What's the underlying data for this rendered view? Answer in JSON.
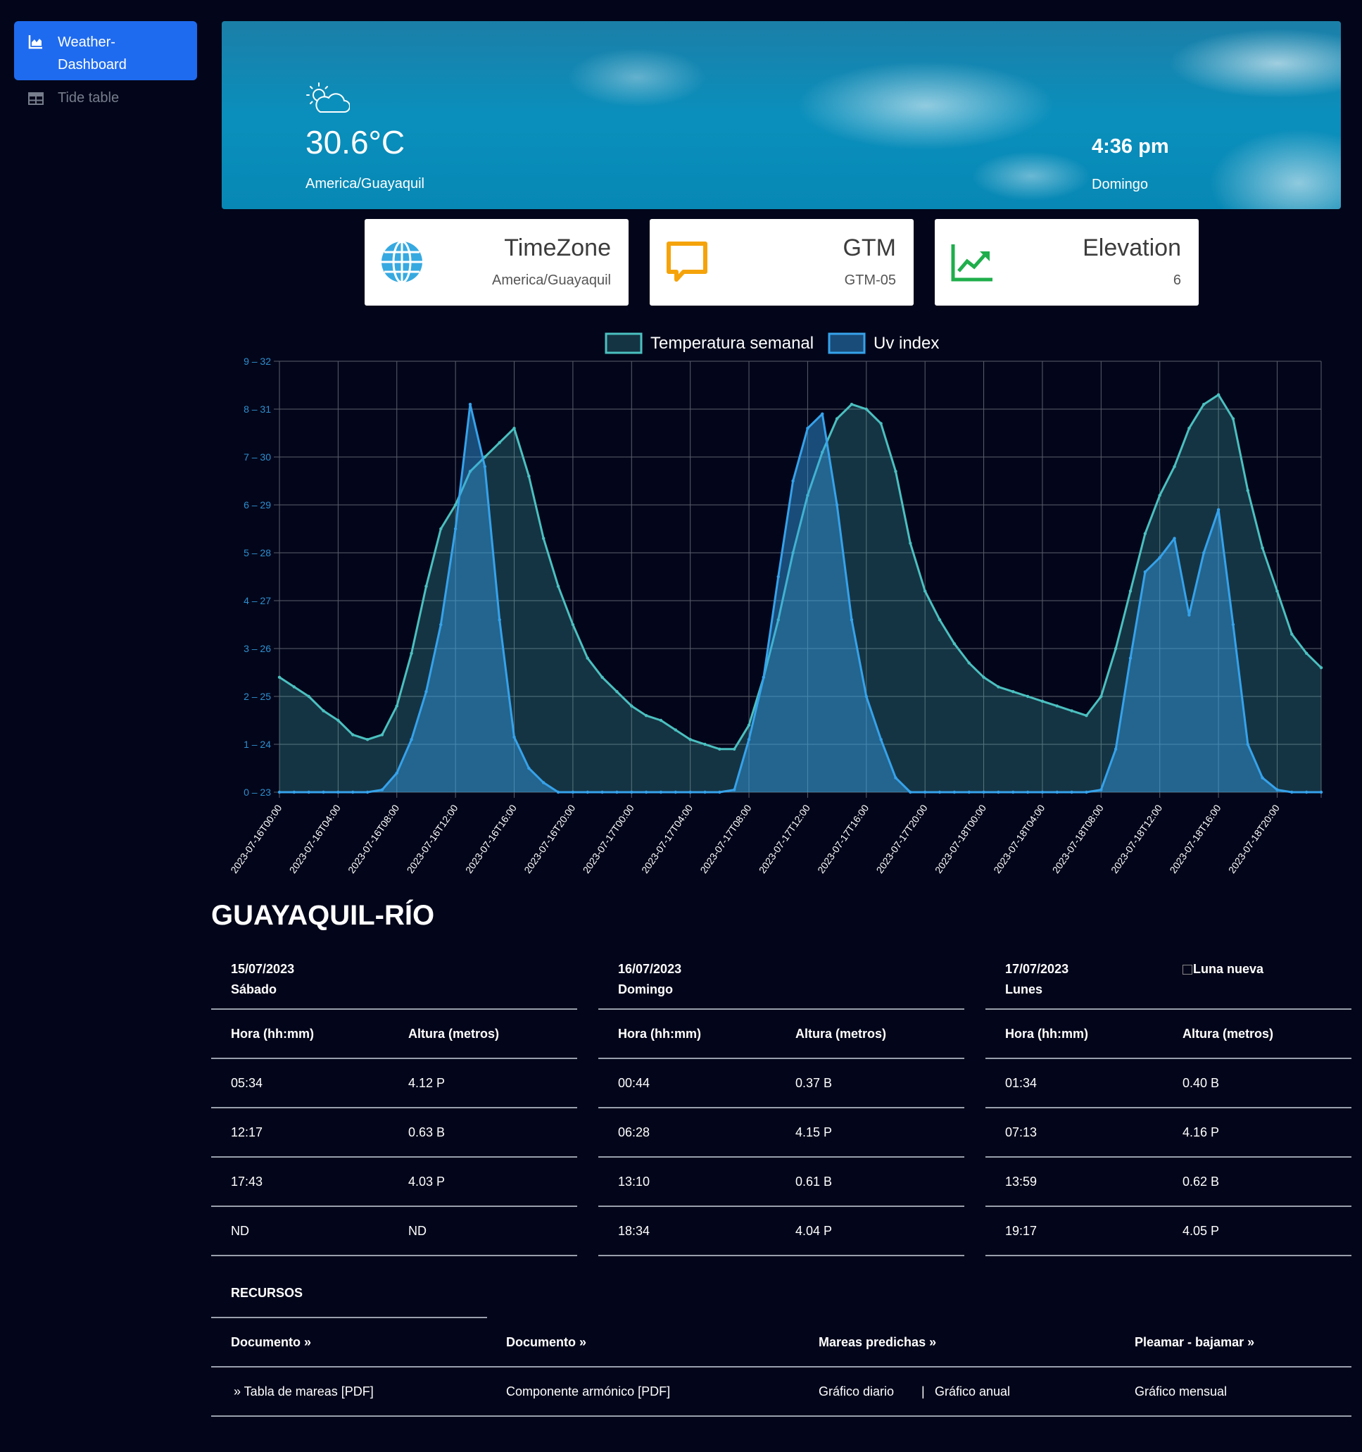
{
  "sidebar": {
    "active_label": "Weather-Dashboard",
    "item_label": "Tide table"
  },
  "hero": {
    "temperature": "30.6°C",
    "timezone": "America/Guayaquil",
    "time": "4:36 pm",
    "day": "Domingo",
    "icon": "partly-cloudy-sun-icon"
  },
  "cards": [
    {
      "title": "TimeZone",
      "value": "America/Guayaquil",
      "icon": "globe-icon",
      "color": "#36a9e1"
    },
    {
      "title": "GTM",
      "value": "GTM-05",
      "icon": "chat-bubble-icon",
      "color": "#f5a30a"
    },
    {
      "title": "Elevation",
      "value": "6",
      "icon": "trending-up-icon",
      "color": "#1fae4b"
    }
  ],
  "chart_data": {
    "type": "area",
    "legend": [
      "Temperatura semanal",
      "Uv index"
    ],
    "legend_position": "top-center",
    "grid": true,
    "y_left_ticks": [
      "9 – 32",
      "8 – 31",
      "7 – 30",
      "6 – 29",
      "5 – 28",
      "4 – 27",
      "3 – 26",
      "2 – 25",
      "1 – 24",
      "0 – 23"
    ],
    "temp_ylim": [
      23,
      32
    ],
    "uv_ylim": [
      0,
      9
    ],
    "x_tick_labels": [
      "2023-07-16T00:00",
      "2023-07-16T04:00",
      "2023-07-16T08:00",
      "2023-07-16T12:00",
      "2023-07-16T16:00",
      "2023-07-16T20:00",
      "2023-07-17T00:00",
      "2023-07-17T04:00",
      "2023-07-17T08:00",
      "2023-07-17T12:00",
      "2023-07-17T16:00",
      "2023-07-17T20:00",
      "2023-07-18T00:00",
      "2023-07-18T04:00",
      "2023-07-18T08:00",
      "2023-07-18T12:00",
      "2023-07-18T16:00",
      "2023-07-18T20:00"
    ],
    "x_start": "2023-07-16T00:00",
    "x_step_hours": 1,
    "series": [
      {
        "name": "Temperatura semanal",
        "color": "#4bc0c0",
        "values": [
          25.4,
          25.2,
          25.0,
          24.7,
          24.5,
          24.2,
          24.1,
          24.2,
          24.8,
          25.9,
          27.3,
          28.5,
          29.0,
          29.7,
          30.0,
          30.3,
          30.6,
          29.6,
          28.3,
          27.3,
          26.5,
          25.8,
          25.4,
          25.1,
          24.8,
          24.6,
          24.5,
          24.3,
          24.1,
          24.0,
          23.9,
          23.9,
          24.4,
          25.4,
          26.6,
          28.0,
          29.2,
          30.1,
          30.8,
          31.1,
          31.0,
          30.7,
          29.7,
          28.2,
          27.2,
          26.6,
          26.1,
          25.7,
          25.4,
          25.2,
          25.1,
          25.0,
          24.9,
          24.8,
          24.7,
          24.6,
          25.0,
          26.0,
          27.2,
          28.4,
          29.2,
          29.8,
          30.6,
          31.1,
          31.3,
          30.8,
          29.3,
          28.1,
          27.2,
          26.3,
          25.9,
          25.6
        ]
      },
      {
        "name": "Uv index",
        "color": "#36a2eb",
        "values": [
          0,
          0,
          0,
          0,
          0,
          0,
          0,
          0.05,
          0.4,
          1.1,
          2.1,
          3.5,
          5.5,
          8.1,
          6.8,
          3.6,
          1.15,
          0.5,
          0.2,
          0,
          0,
          0,
          0,
          0,
          0,
          0,
          0,
          0,
          0,
          0,
          0,
          0.05,
          1.1,
          2.4,
          4.5,
          6.5,
          7.6,
          7.9,
          6.0,
          3.6,
          2.0,
          1.1,
          0.3,
          0,
          0,
          0,
          0,
          0,
          0,
          0,
          0,
          0,
          0,
          0,
          0,
          0,
          0.05,
          0.9,
          2.8,
          4.6,
          4.9,
          5.3,
          3.7,
          5.0,
          5.9,
          3.5,
          1.0,
          0.3,
          0.05,
          0,
          0,
          0
        ]
      }
    ]
  },
  "tide": {
    "title": "GUAYAQUIL-RÍO",
    "col_hora": "Hora (hh:mm)",
    "col_altura": "Altura (metros)",
    "moon_alt": "Luna nueva",
    "days": [
      {
        "date": "15/07/2023",
        "weekday": "Sábado",
        "rows": [
          [
            "05:34",
            "4.12 P"
          ],
          [
            "12:17",
            "0.63 B"
          ],
          [
            "17:43",
            "4.03 P"
          ],
          [
            "ND",
            "ND"
          ]
        ]
      },
      {
        "date": "16/07/2023",
        "weekday": "Domingo",
        "rows": [
          [
            "00:44",
            "0.37 B"
          ],
          [
            "06:28",
            "4.15 P"
          ],
          [
            "13:10",
            "0.61 B"
          ],
          [
            "18:34",
            "4.04 P"
          ]
        ]
      },
      {
        "date": "17/07/2023",
        "weekday": "Lunes",
        "rows": [
          [
            "01:34",
            "0.40 B"
          ],
          [
            "07:13",
            "4.16 P"
          ],
          [
            "13:59",
            "0.62 B"
          ],
          [
            "19:17",
            "4.05 P"
          ]
        ]
      }
    ]
  },
  "recursos": {
    "title": "RECURSOS",
    "headers": [
      "Documento »",
      "Documento »",
      "Mareas predichas »",
      "Pleamar - bajamar »"
    ],
    "links": {
      "tabla": "» Tabla de mareas [PDF]",
      "componente": "Componente armónico [PDF]",
      "diario": "Gráfico diario",
      "sep": "|",
      "anual": "Gráfico anual",
      "mensual": "Gráfico mensual"
    }
  }
}
